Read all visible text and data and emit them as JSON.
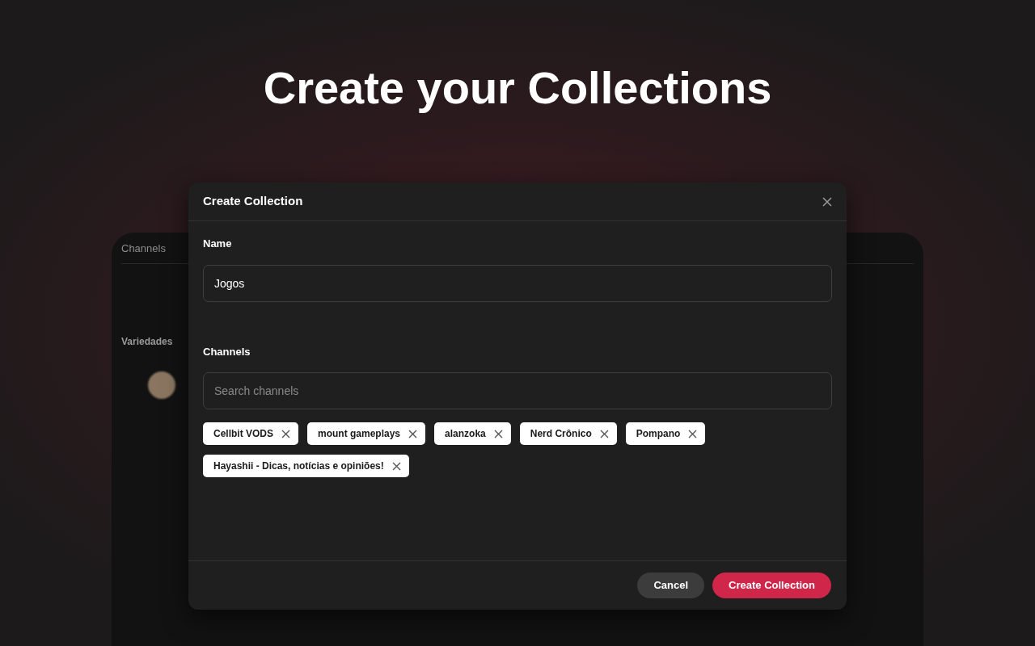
{
  "heading": "Create your Collections",
  "background_app": {
    "tab": "Channels",
    "section": "Variedades"
  },
  "dialog": {
    "title": "Create Collection",
    "name_label": "Name",
    "name_value": "Jogos",
    "channels_label": "Channels",
    "search": {
      "placeholder": "Search channels"
    },
    "chips": [
      {
        "label": "Cellbit VODS"
      },
      {
        "label": "mount gameplays"
      },
      {
        "label": "alanzoka"
      },
      {
        "label": "Nerd Crônico"
      },
      {
        "label": "Pompano"
      },
      {
        "label": "Hayashii - Dicas, notícias e opiniões!"
      }
    ],
    "buttons": [
      {
        "label": "Cancel",
        "kind": "secondary"
      },
      {
        "label": "Create Collection",
        "kind": "primary"
      }
    ]
  }
}
